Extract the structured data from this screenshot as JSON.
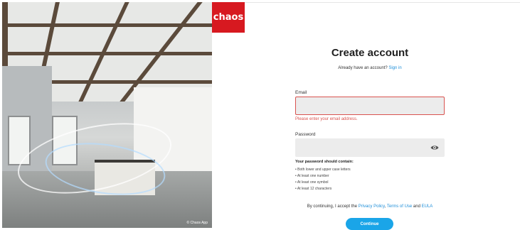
{
  "brand": {
    "logo_text": "chaos",
    "color": "#d71920"
  },
  "hero": {
    "caption": "© Chaos App"
  },
  "form": {
    "title": "Create account",
    "subtitle_text": "Already have an account?",
    "signin_link": "Sign in",
    "email_label": "Email",
    "email_value": "",
    "email_error": "Please enter your email address.",
    "password_label": "Password",
    "password_value": "",
    "rules_title": "Your password should contain:",
    "rules": [
      "Both lower and upper case letters",
      "At least one number",
      "At least one symbol",
      "At least 12 characters"
    ],
    "consent_prefix": "By continuing, I accept the",
    "privacy_link": "Privacy Policy",
    "terms_link": "Terms of Use",
    "and_text": "and",
    "eula_link": "EULA",
    "continue_label": "Continue"
  },
  "colors": {
    "accent": "#1aa5e8",
    "link": "#1f8fd9",
    "error": "#d9534f"
  }
}
